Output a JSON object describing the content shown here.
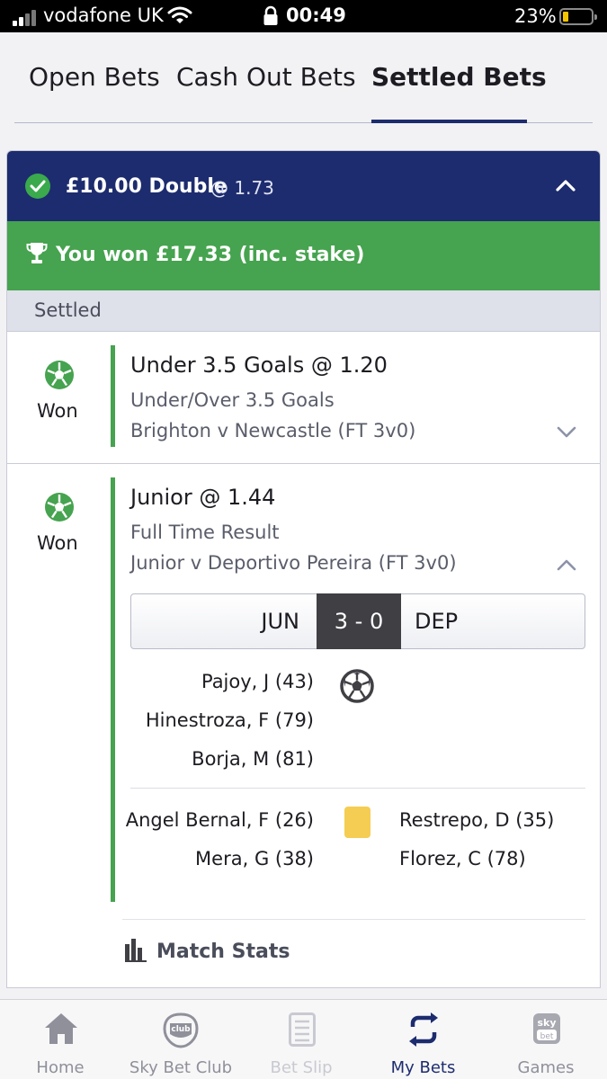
{
  "status_bar": {
    "carrier": "vodafone UK",
    "time": "00:49",
    "battery": "23%",
    "battery_level": 0.23
  },
  "tabs": [
    {
      "label": "Open Bets",
      "active": false
    },
    {
      "label": "Cash Out Bets",
      "active": false
    },
    {
      "label": "Settled Bets",
      "active": true
    }
  ],
  "bet": {
    "stake_type": "£10.00 Double",
    "odds": "@ 1.73",
    "won_text": "You won £17.33 (inc. stake)",
    "status_section": "Settled",
    "legs": [
      {
        "result": "Won",
        "selection": "Under 3.5 Goals @ 1.20",
        "market": "Under/Over 3.5 Goals",
        "event": "Brighton v Newcastle (FT 3v0)"
      },
      {
        "result": "Won",
        "selection": "Junior @ 1.44",
        "market": "Full Time Result",
        "event": "Junior v Deportivo Pereira (FT 3v0)",
        "scoreboard": {
          "home": "JUN",
          "score": "3 - 0",
          "away": "DEP"
        },
        "goals": {
          "home": [
            "Pajoy, J (43)",
            "Hinestroza, F (79)",
            "Borja, M (81)"
          ],
          "away": []
        },
        "yellow_cards": {
          "home": [
            "Angel Bernal, F (26)",
            "Mera, G (38)"
          ],
          "away": [
            "Restrepo, D (35)",
            "Florez, C (78)"
          ]
        },
        "match_stats_label": "Match Stats"
      }
    ]
  },
  "bottom_nav": [
    {
      "label": "Home",
      "icon": "home-icon",
      "state": "normal"
    },
    {
      "label": "Sky Bet Club",
      "icon": "sky-bet-club-icon",
      "state": "normal"
    },
    {
      "label": "Bet Slip",
      "icon": "bet-slip-icon",
      "state": "disabled"
    },
    {
      "label": "My Bets",
      "icon": "my-bets-icon",
      "state": "active"
    },
    {
      "label": "Games",
      "icon": "sky-bet-games-icon",
      "state": "normal"
    }
  ],
  "colors": {
    "navy": "#1d2c6e",
    "green": "#46a34f",
    "yellow_card": "#f5cd52"
  }
}
